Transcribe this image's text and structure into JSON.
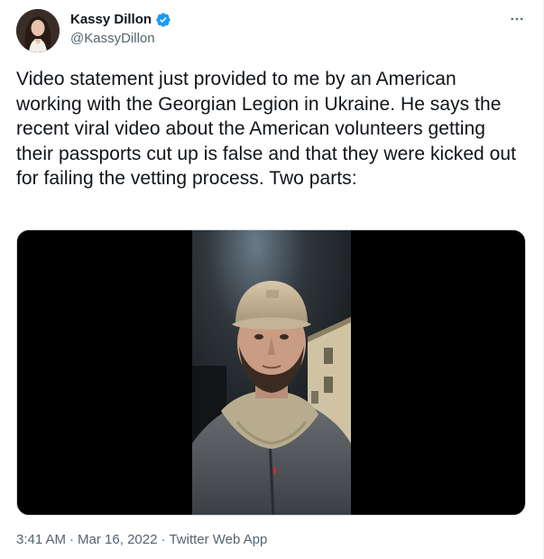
{
  "author": {
    "display_name": "Kassy Dillon",
    "handle": "@KassyDillon",
    "verified": true,
    "avatar_icon": "profile-photo"
  },
  "tweet": {
    "text": "Video statement just provided to me by an American working with the Georgian Legion in Ukraine. He says the recent viral video about the American volunteers getting their passports cut up is false and that they were kicked out for failing the vetting process. Two parts:"
  },
  "meta": {
    "time": "3:41 AM",
    "separator": "·",
    "date": "Mar 16, 2022",
    "source": "Twitter Web App"
  },
  "colors": {
    "verified_blue": "#1d9bf0",
    "text_primary": "#0f1419",
    "text_secondary": "#536471"
  },
  "icons": {
    "more": "more-horizontal-icon",
    "verified": "verified-badge-icon"
  }
}
